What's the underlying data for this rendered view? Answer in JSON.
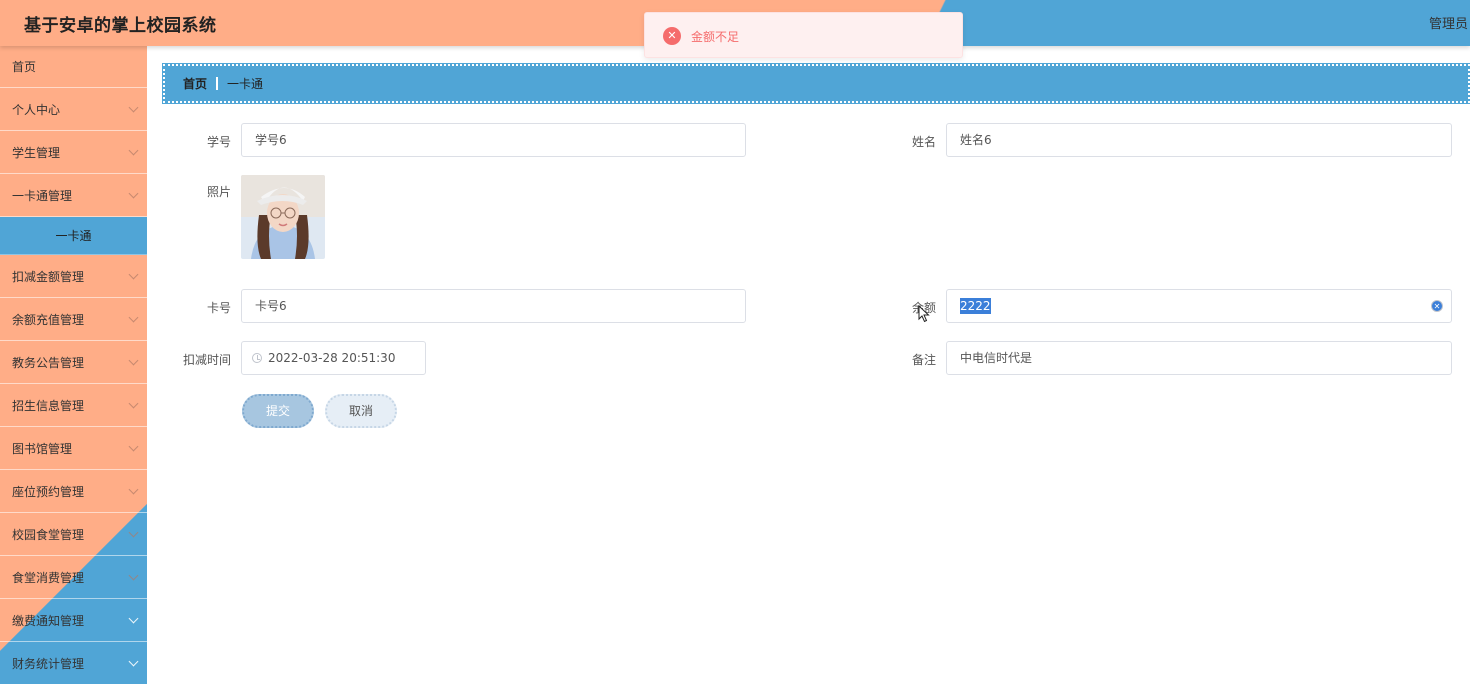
{
  "header": {
    "app_title": "基于安卓的掌上校园系统",
    "user_label": "管理员"
  },
  "toast": {
    "message": "金额不足",
    "icon": "error-icon",
    "color": "#f56c6c"
  },
  "sidebar": {
    "items": [
      {
        "label": "首页",
        "has_children": false
      },
      {
        "label": "个人中心",
        "has_children": true
      },
      {
        "label": "学生管理",
        "has_children": true
      },
      {
        "label": "一卡通管理",
        "has_children": true
      },
      {
        "label": "一卡通",
        "sub": true,
        "active": true
      },
      {
        "label": "扣减金额管理",
        "has_children": true
      },
      {
        "label": "余额充值管理",
        "has_children": true
      },
      {
        "label": "教务公告管理",
        "has_children": true
      },
      {
        "label": "招生信息管理",
        "has_children": true
      },
      {
        "label": "图书馆管理",
        "has_children": true
      },
      {
        "label": "座位预约管理",
        "has_children": true
      },
      {
        "label": "校园食堂管理",
        "has_children": true
      },
      {
        "label": "食堂消费管理",
        "has_children": true
      },
      {
        "label": "缴费通知管理",
        "has_children": true
      },
      {
        "label": "财务统计管理",
        "has_children": true
      }
    ]
  },
  "breadcrumb": {
    "home": "首页",
    "current": "一卡通"
  },
  "form": {
    "student_id_label": "学号",
    "student_id_value": "学号6",
    "name_label": "姓名",
    "name_value": "姓名6",
    "photo_label": "照片",
    "card_no_label": "卡号",
    "card_no_value": "卡号6",
    "balance_label": "余额",
    "balance_value": "2222",
    "deduct_time_label": "扣减时间",
    "deduct_time_value": "2022-03-28 20:51:30",
    "remark_label": "备注",
    "remark_value": "中电信时代是",
    "submit_label": "提交",
    "cancel_label": "取消"
  },
  "colors": {
    "brand_orange": "#ffad87",
    "brand_blue": "#50a5d6",
    "error": "#f56c6c"
  }
}
